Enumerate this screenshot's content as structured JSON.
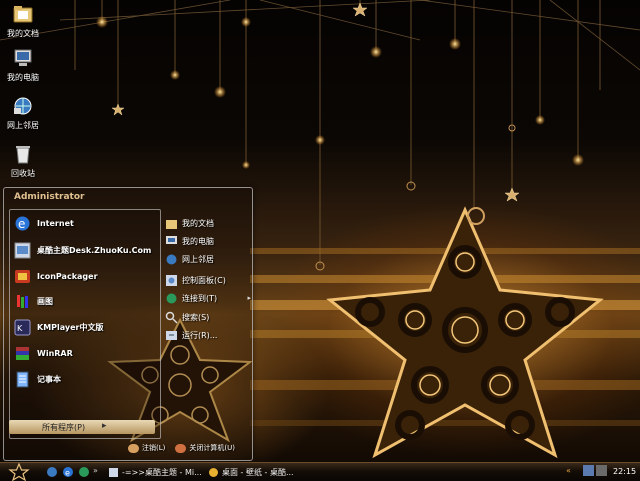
{
  "desktop": {
    "icons": [
      {
        "label": "我的文档"
      },
      {
        "label": "我的电脑"
      },
      {
        "label": "网上邻居"
      },
      {
        "label": "回收站"
      }
    ]
  },
  "start_menu": {
    "user": "Administrator",
    "left_items": [
      {
        "label": "Internet",
        "icon": "internet-explorer-icon"
      },
      {
        "label": "桌酷主题Desk.ZhuoKu.Com",
        "icon": "zhuoku-theme-icon"
      },
      {
        "label": "IconPackager",
        "icon": "iconpackager-icon"
      },
      {
        "label": "画图",
        "icon": "paint-icon"
      },
      {
        "label": "KMPlayer中文版",
        "icon": "kmplayer-icon"
      },
      {
        "label": "WinRAR",
        "icon": "winrar-icon"
      },
      {
        "label": "记事本",
        "icon": "notepad-icon"
      }
    ],
    "all_programs": "所有程序(P)",
    "right_items": [
      {
        "label": "我的文档",
        "icon": "my-documents-icon"
      },
      {
        "label": "我的电脑",
        "icon": "my-computer-icon"
      },
      {
        "label": "网上邻居",
        "icon": "network-icon"
      },
      {
        "label": "控制面板(C)",
        "icon": "control-panel-icon"
      },
      {
        "label": "连接到(T)",
        "icon": "connect-icon"
      },
      {
        "label": "搜索(S)",
        "icon": "search-icon"
      },
      {
        "label": "运行(R)...",
        "icon": "run-icon"
      }
    ],
    "logoff": "注销(L)",
    "shutdown": "关闭计算机(U)"
  },
  "taskbar": {
    "separator": "»",
    "tasks": [
      {
        "label": "-=>>桌酷主题 - Mi..."
      },
      {
        "label": "桌面 - 壁纸 - 桌酷..."
      }
    ],
    "tray_arrow": "«",
    "clock": "22:15"
  },
  "colors": {
    "accent": "#e0c090",
    "taskbar": "#140d07"
  }
}
